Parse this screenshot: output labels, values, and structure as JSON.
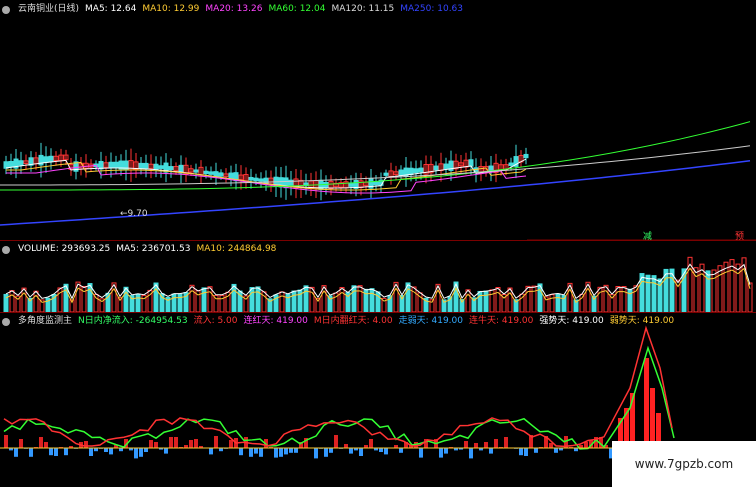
{
  "price_header": {
    "title": "云南铜业(日线)",
    "items": [
      {
        "label": "MA5: 12.64",
        "color": "#ffffff"
      },
      {
        "label": "MA10: 12.99",
        "color": "#ffcc33"
      },
      {
        "label": "MA20: 13.26",
        "color": "#ff44ff"
      },
      {
        "label": "MA60: 12.04",
        "color": "#33ff33"
      },
      {
        "label": "MA120: 11.15",
        "color": "#dddddd"
      },
      {
        "label": "MA250: 10.63",
        "color": "#3344ff"
      }
    ]
  },
  "price_annotation": "←9.70",
  "price_tags": [
    {
      "text": "减",
      "color": "#33ff66"
    },
    {
      "text": "预",
      "color": "#ff3333"
    }
  ],
  "volume_header": {
    "items": [
      {
        "label": "VOLUME: 293693.25",
        "color": "#ffffff"
      },
      {
        "label": "MA5: 236701.53",
        "color": "#ffffff"
      },
      {
        "label": "MA10: 244864.98",
        "color": "#ffcc33"
      }
    ]
  },
  "indicator_header": {
    "title": "多角度监测主",
    "items": [
      {
        "label": "N日内净流入: -264954.53",
        "color": "#33ff66"
      },
      {
        "label": "流入: 5.00",
        "color": "#ff3333"
      },
      {
        "label": "连红天: 419.00",
        "color": "#ff44ff"
      },
      {
        "label": "M日内翻红天: 4.00",
        "color": "#ff3333"
      },
      {
        "label": "走弱天: 419.00",
        "color": "#33aaff"
      },
      {
        "label": "连牛天: 419.00",
        "color": "#ff3333"
      },
      {
        "label": "强势天: 419.00",
        "color": "#ffffff"
      },
      {
        "label": "弱势天: 419.00",
        "color": "#ffcc33"
      }
    ]
  },
  "watermark": "www.7gpzb.com",
  "colors": {
    "up": "#ff3333",
    "down": "#44dddd",
    "separator": "#7a0000"
  }
}
